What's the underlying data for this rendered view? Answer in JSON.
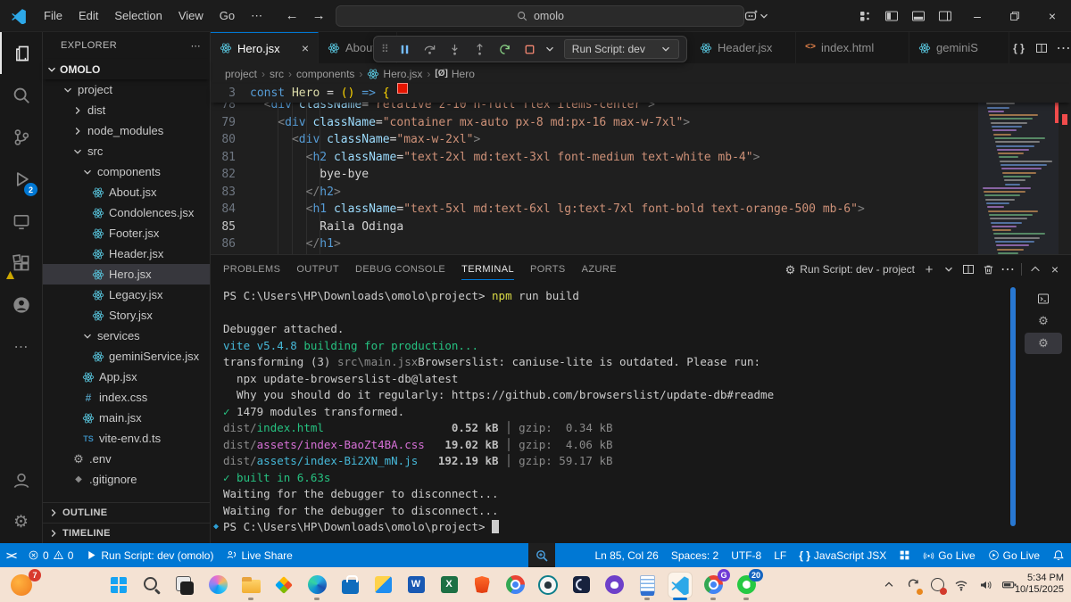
{
  "title_bar": {
    "menus": [
      "File",
      "Edit",
      "Selection",
      "View",
      "Go",
      "⋯"
    ],
    "search_text": "omolo",
    "window_controls": [
      "minimize",
      "restore",
      "close"
    ]
  },
  "activity_bar": {
    "top": [
      {
        "name": "explorer",
        "icon": "files-icon",
        "active": true
      },
      {
        "name": "search",
        "icon": "search-icon"
      },
      {
        "name": "source-control",
        "icon": "source-control-icon"
      },
      {
        "name": "run-debug",
        "icon": "run-debug-icon",
        "badge": "2"
      },
      {
        "name": "remote-explorer",
        "icon": "remote-explorer-icon"
      },
      {
        "name": "extensions",
        "icon": "extensions-icon",
        "warn": true
      },
      {
        "name": "github",
        "icon": "github-icon"
      },
      {
        "name": "more-views",
        "icon": "more-icon"
      }
    ],
    "bottom": [
      {
        "name": "accounts",
        "icon": "account-icon"
      },
      {
        "name": "settings",
        "icon": "settings-icon"
      }
    ]
  },
  "sidebar": {
    "title": "EXPLORER",
    "root": "OMOLO",
    "tree": [
      {
        "label": "project",
        "level": 1,
        "chev": "down"
      },
      {
        "label": "dist",
        "level": 2,
        "chev": "right"
      },
      {
        "label": "node_modules",
        "level": 2,
        "chev": "right"
      },
      {
        "label": "src",
        "level": 2,
        "chev": "down"
      },
      {
        "label": "components",
        "level": 3,
        "chev": "down"
      },
      {
        "label": "About.jsx",
        "level": 4,
        "icon": "react-icon"
      },
      {
        "label": "Condolences.jsx",
        "level": 4,
        "icon": "react-icon"
      },
      {
        "label": "Footer.jsx",
        "level": 4,
        "icon": "react-icon"
      },
      {
        "label": "Header.jsx",
        "level": 4,
        "icon": "react-icon"
      },
      {
        "label": "Hero.jsx",
        "level": 4,
        "icon": "react-icon",
        "selected": true
      },
      {
        "label": "Legacy.jsx",
        "level": 4,
        "icon": "react-icon"
      },
      {
        "label": "Story.jsx",
        "level": 4,
        "icon": "react-icon"
      },
      {
        "label": "services",
        "level": 3,
        "chev": "down"
      },
      {
        "label": "geminiService.jsx",
        "level": 4,
        "icon": "react-icon"
      },
      {
        "label": "App.jsx",
        "level": 3,
        "icon": "react-icon"
      },
      {
        "label": "index.css",
        "level": 3,
        "icon": "css-icon"
      },
      {
        "label": "main.jsx",
        "level": 3,
        "icon": "react-icon"
      },
      {
        "label": "vite-env.d.ts",
        "level": 3,
        "icon": "ts-icon"
      },
      {
        "label": ".env",
        "level": 2,
        "icon": "gear-icon"
      },
      {
        "label": ".gitignore",
        "level": 2,
        "icon": "git-icon"
      }
    ],
    "sections": [
      "OUTLINE",
      "TIMELINE"
    ]
  },
  "editor": {
    "tabs": [
      {
        "label": "Hero.jsx",
        "icon": "react-icon",
        "active": true,
        "close": true
      },
      {
        "label": "About",
        "icon": "react-icon"
      },
      {
        "label": "Header.jsx",
        "icon": "react-icon"
      },
      {
        "label": "index.html",
        "icon": "html-icon"
      },
      {
        "label": "geminiS",
        "icon": "react-icon"
      }
    ],
    "tab_actions": [
      {
        "name": "braces-action",
        "icon": "braces-icon"
      },
      {
        "name": "split-editor",
        "icon": "split-icon"
      },
      {
        "name": "more-actions",
        "icon": "more-icon"
      }
    ],
    "breadcrumbs": [
      {
        "label": "project"
      },
      {
        "label": "src"
      },
      {
        "label": "components"
      },
      {
        "label": "Hero.jsx",
        "icon": "react-icon"
      },
      {
        "label": "Hero",
        "icon": "symbol-icon"
      }
    ],
    "sticky": {
      "num": "3",
      "segs": [
        [
          "k",
          "const"
        ],
        [
          "p",
          " "
        ],
        [
          "f",
          "Hero"
        ],
        [
          "p",
          " = "
        ],
        [
          "b",
          "()"
        ],
        [
          "p",
          " "
        ],
        [
          "k",
          "=>"
        ],
        [
          "p",
          " "
        ],
        [
          "b",
          "{"
        ]
      ]
    },
    "current_line": "85",
    "code_lines": [
      {
        "num": "78",
        "segs": [
          [
            "g",
            "  <"
          ],
          [
            "t",
            "div"
          ],
          [
            "p",
            " "
          ],
          [
            "a",
            "className"
          ],
          [
            "p",
            "="
          ],
          [
            "s",
            "\"relative z-10 h-full flex items-center\""
          ],
          [
            "g",
            ">"
          ]
        ]
      },
      {
        "num": "79",
        "segs": [
          [
            "g",
            "    <"
          ],
          [
            "t",
            "div"
          ],
          [
            "p",
            " "
          ],
          [
            "a",
            "className"
          ],
          [
            "p",
            "="
          ],
          [
            "s",
            "\"container mx-auto px-8 md:px-16 max-w-7xl\""
          ],
          [
            "g",
            ">"
          ]
        ]
      },
      {
        "num": "80",
        "segs": [
          [
            "g",
            "      <"
          ],
          [
            "t",
            "div"
          ],
          [
            "p",
            " "
          ],
          [
            "a",
            "className"
          ],
          [
            "p",
            "="
          ],
          [
            "s",
            "\"max-w-2xl\""
          ],
          [
            "g",
            ">"
          ]
        ]
      },
      {
        "num": "81",
        "segs": [
          [
            "g",
            "        <"
          ],
          [
            "t",
            "h2"
          ],
          [
            "p",
            " "
          ],
          [
            "a",
            "className"
          ],
          [
            "p",
            "="
          ],
          [
            "s",
            "\"text-2xl md:text-3xl font-medium text-white mb-4\""
          ],
          [
            "g",
            ">"
          ]
        ]
      },
      {
        "num": "82",
        "segs": [
          [
            "x",
            "          bye-bye"
          ]
        ]
      },
      {
        "num": "83",
        "segs": [
          [
            "g",
            "        </"
          ],
          [
            "t",
            "h2"
          ],
          [
            "g",
            ">"
          ]
        ]
      },
      {
        "num": "84",
        "segs": [
          [
            "g",
            "        <"
          ],
          [
            "t",
            "h1"
          ],
          [
            "p",
            " "
          ],
          [
            "a",
            "className"
          ],
          [
            "p",
            "="
          ],
          [
            "s",
            "\"text-5xl md:text-6xl lg:text-7xl font-bold text-orange-500 mb-6\""
          ],
          [
            "g",
            ">"
          ]
        ]
      },
      {
        "num": "85",
        "segs": [
          [
            "x",
            "          Raila Odinga"
          ]
        ]
      },
      {
        "num": "86",
        "segs": [
          [
            "g",
            "        </"
          ],
          [
            "t",
            "h1"
          ],
          [
            "g",
            ">"
          ]
        ]
      }
    ]
  },
  "debug_toolbar": {
    "run_script_label": "Run Script: dev"
  },
  "panel": {
    "tabs": [
      {
        "label": "PROBLEMS"
      },
      {
        "label": "OUTPUT"
      },
      {
        "label": "DEBUG CONSOLE"
      },
      {
        "label": "TERMINAL",
        "active": true
      },
      {
        "label": "PORTS"
      },
      {
        "label": "AZURE"
      }
    ],
    "task_label": "Run Script: dev - project",
    "actions": [
      {
        "name": "new-terminal",
        "icon": "plus-icon"
      },
      {
        "name": "terminal-dropdown",
        "icon": "chevron-down-icon"
      },
      {
        "name": "split-terminal",
        "icon": "split-icon"
      },
      {
        "name": "kill-terminal",
        "icon": "trash-icon"
      },
      {
        "name": "more-actions",
        "icon": "more-icon"
      },
      {
        "name": "divider",
        "icon": ""
      },
      {
        "name": "maximize-panel",
        "icon": "maximize-icon"
      },
      {
        "name": "close-panel",
        "icon": "close-icon"
      }
    ],
    "terminal_lines": [
      {
        "segs": [
          [
            "w",
            "PS C:\\Users\\HP\\Downloads\\omolo\\project> "
          ],
          [
            "y",
            "npm"
          ],
          [
            "w",
            " run build"
          ]
        ]
      },
      {
        "segs": []
      },
      {
        "segs": [
          [
            "w",
            "Debugger attached."
          ]
        ]
      },
      {
        "segs": [
          [
            "c",
            "vite v5.4.8 "
          ],
          [
            "g",
            "building for production..."
          ]
        ]
      },
      {
        "segs": [
          [
            "w",
            "transforming (3) "
          ],
          [
            "d",
            "src\\main.jsx"
          ],
          [
            "w",
            "Browserslist: caniuse-lite is outdated. Please run:"
          ]
        ]
      },
      {
        "segs": [
          [
            "w",
            "  npx update-browserslist-db@latest"
          ]
        ]
      },
      {
        "segs": [
          [
            "w",
            "  Why you should do it regularly: https://github.com/browserslist/update-db#readme"
          ]
        ]
      },
      {
        "segs": [
          [
            "g",
            "✓"
          ],
          [
            "w",
            " 1479 modules transformed."
          ]
        ]
      },
      {
        "segs": [
          [
            "d",
            "dist/"
          ],
          [
            "g",
            "index.html"
          ],
          [
            "s",
            "                   0.52 kB"
          ],
          [
            "d",
            " │ gzip:  0.34 kB"
          ]
        ]
      },
      {
        "segs": [
          [
            "d",
            "dist/"
          ],
          [
            "m",
            "assets/index-BaoZt4BA.css"
          ],
          [
            "s",
            "   19.02 kB"
          ],
          [
            "d",
            " │ gzip:  4.06 kB"
          ]
        ]
      },
      {
        "segs": [
          [
            "d",
            "dist/"
          ],
          [
            "c",
            "assets/index-Bi2XN_mN.js"
          ],
          [
            "s",
            "   192.19 kB"
          ],
          [
            "d",
            " │ gzip: 59.17 kB"
          ]
        ]
      },
      {
        "segs": [
          [
            "g",
            "✓ built in 6.63s"
          ]
        ]
      },
      {
        "segs": [
          [
            "w",
            "Waiting for the debugger to disconnect..."
          ]
        ]
      },
      {
        "segs": [
          [
            "w",
            "Waiting for the debugger to disconnect..."
          ]
        ]
      },
      {
        "deco": true,
        "cursor": true,
        "segs": [
          [
            "w",
            "PS C:\\Users\\HP\\Downloads\\omolo\\project> "
          ]
        ]
      }
    ],
    "side_items": [
      {
        "name": "terminal-powershell",
        "icon": "terminal-icon"
      },
      {
        "name": "terminal-task-1",
        "icon": "gear-icon"
      },
      {
        "name": "terminal-task-2",
        "icon": "gear-icon",
        "selected": true
      }
    ]
  },
  "status_bar": {
    "left": [
      {
        "name": "remote-indicator",
        "icon": "remote-icon",
        "text": ""
      },
      {
        "name": "problems",
        "error": "0",
        "warning": "0"
      },
      {
        "name": "debug-status",
        "icon": "debug-icon",
        "text": "Run Script: dev (omolo)"
      },
      {
        "name": "live-share",
        "icon": "liveshare-icon",
        "text": "Live Share"
      }
    ],
    "right": [
      {
        "name": "cursor-position",
        "text": "Ln 85, Col 26"
      },
      {
        "name": "indentation",
        "text": "Spaces: 2"
      },
      {
        "name": "encoding",
        "text": "UTF-8"
      },
      {
        "name": "eol",
        "text": "LF"
      },
      {
        "name": "language-mode",
        "icon": "braces-icon",
        "text": "JavaScript JSX"
      },
      {
        "name": "extension-grid",
        "icon": "grid-icon",
        "text": ""
      },
      {
        "name": "go-live-broadcast",
        "icon": "broadcast-icon",
        "text": "Go Live"
      },
      {
        "name": "go-live-play",
        "icon": "play-circle-icon",
        "text": "Go Live"
      },
      {
        "name": "notifications",
        "icon": "bell-icon",
        "text": ""
      }
    ]
  },
  "taskbar": {
    "widget_badge": "7",
    "apps": [
      {
        "key": "start",
        "name": "start-button"
      },
      {
        "key": "search",
        "name": "taskbar-search"
      },
      {
        "key": "taskview",
        "name": "task-view"
      },
      {
        "key": "copilot",
        "name": "copilot"
      },
      {
        "key": "explorer",
        "name": "file-explorer",
        "running": true
      },
      {
        "key": "paint",
        "name": "ms-365"
      },
      {
        "key": "edge",
        "name": "edge",
        "running": true
      },
      {
        "key": "store",
        "name": "microsoft-store"
      },
      {
        "key": "photos",
        "name": "photos"
      },
      {
        "key": "word",
        "name": "word"
      },
      {
        "key": "excel",
        "name": "excel"
      },
      {
        "key": "brave",
        "name": "brave"
      },
      {
        "key": "chrome",
        "name": "chrome"
      },
      {
        "key": "dog",
        "name": "app-pet"
      },
      {
        "key": "navy",
        "name": "app-dark"
      },
      {
        "key": "github",
        "name": "github-desktop"
      },
      {
        "key": "notepad",
        "name": "notepad",
        "running": true
      },
      {
        "key": "vscode",
        "name": "vscode",
        "active": true
      },
      {
        "key": "chromeg",
        "name": "chrome-gemini",
        "badge": "G",
        "badge_color": "bg-purple",
        "running": true
      },
      {
        "key": "whatsapp",
        "name": "whatsapp",
        "badge": "20",
        "badge_color": "bg-blue",
        "running": true
      }
    ],
    "tray": [
      "tray-chevron",
      "tray-sync",
      "tray-alert",
      "tray-wifi",
      "tray-volume",
      "tray-battery"
    ],
    "time": "5:34 PM",
    "date": "10/15/2025"
  },
  "colors": {
    "accent_blue": "#0078d4",
    "react_icon": "#58c4dc",
    "error_red": "#f14c4c",
    "terminal_scrollbar": "#2878d2",
    "taskbar_bg": "#f4e2d3",
    "status_bar": "#0078d4"
  }
}
